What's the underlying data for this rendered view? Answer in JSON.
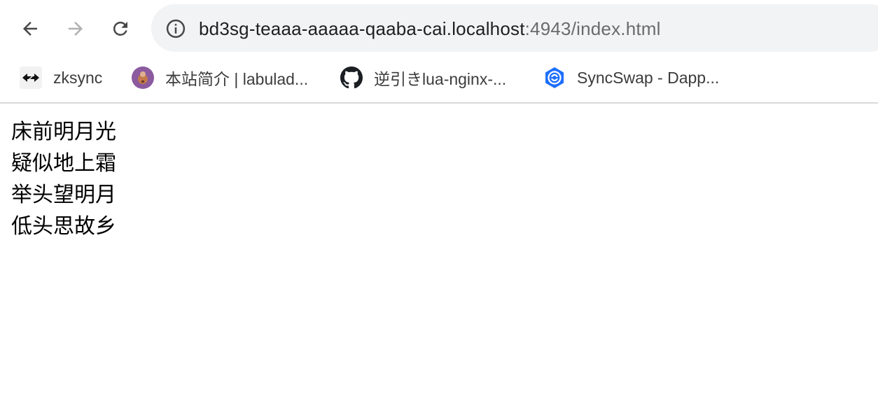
{
  "toolbar": {
    "back_icon": "arrow-left-icon",
    "forward_icon": "arrow-right-icon",
    "reload_icon": "reload-icon",
    "info_icon": "info-circle-icon"
  },
  "omnibox": {
    "host": "bd3sg-teaaa-aaaaa-qaaba-cai.localhost",
    "path": ":4943/index.html"
  },
  "bookmarks": [
    {
      "label": "zksync",
      "icon": "zksync-arrows-icon"
    },
    {
      "label": "本站简介 | labulad...",
      "icon": "labuladong-avatar-icon"
    },
    {
      "label": "逆引きlua-nginx-...",
      "icon": "github-icon"
    },
    {
      "label": "SyncSwap - Dapp...",
      "icon": "syncswap-icon"
    }
  ],
  "page": {
    "lines": [
      "床前明月光",
      "疑似地上霜",
      "举头望明月",
      "低头思故乡"
    ]
  },
  "colors": {
    "omnibox_bg": "#f1f3f4",
    "syncswap_blue": "#1e6fff",
    "labuladong_purple": "#8b5a9f"
  }
}
